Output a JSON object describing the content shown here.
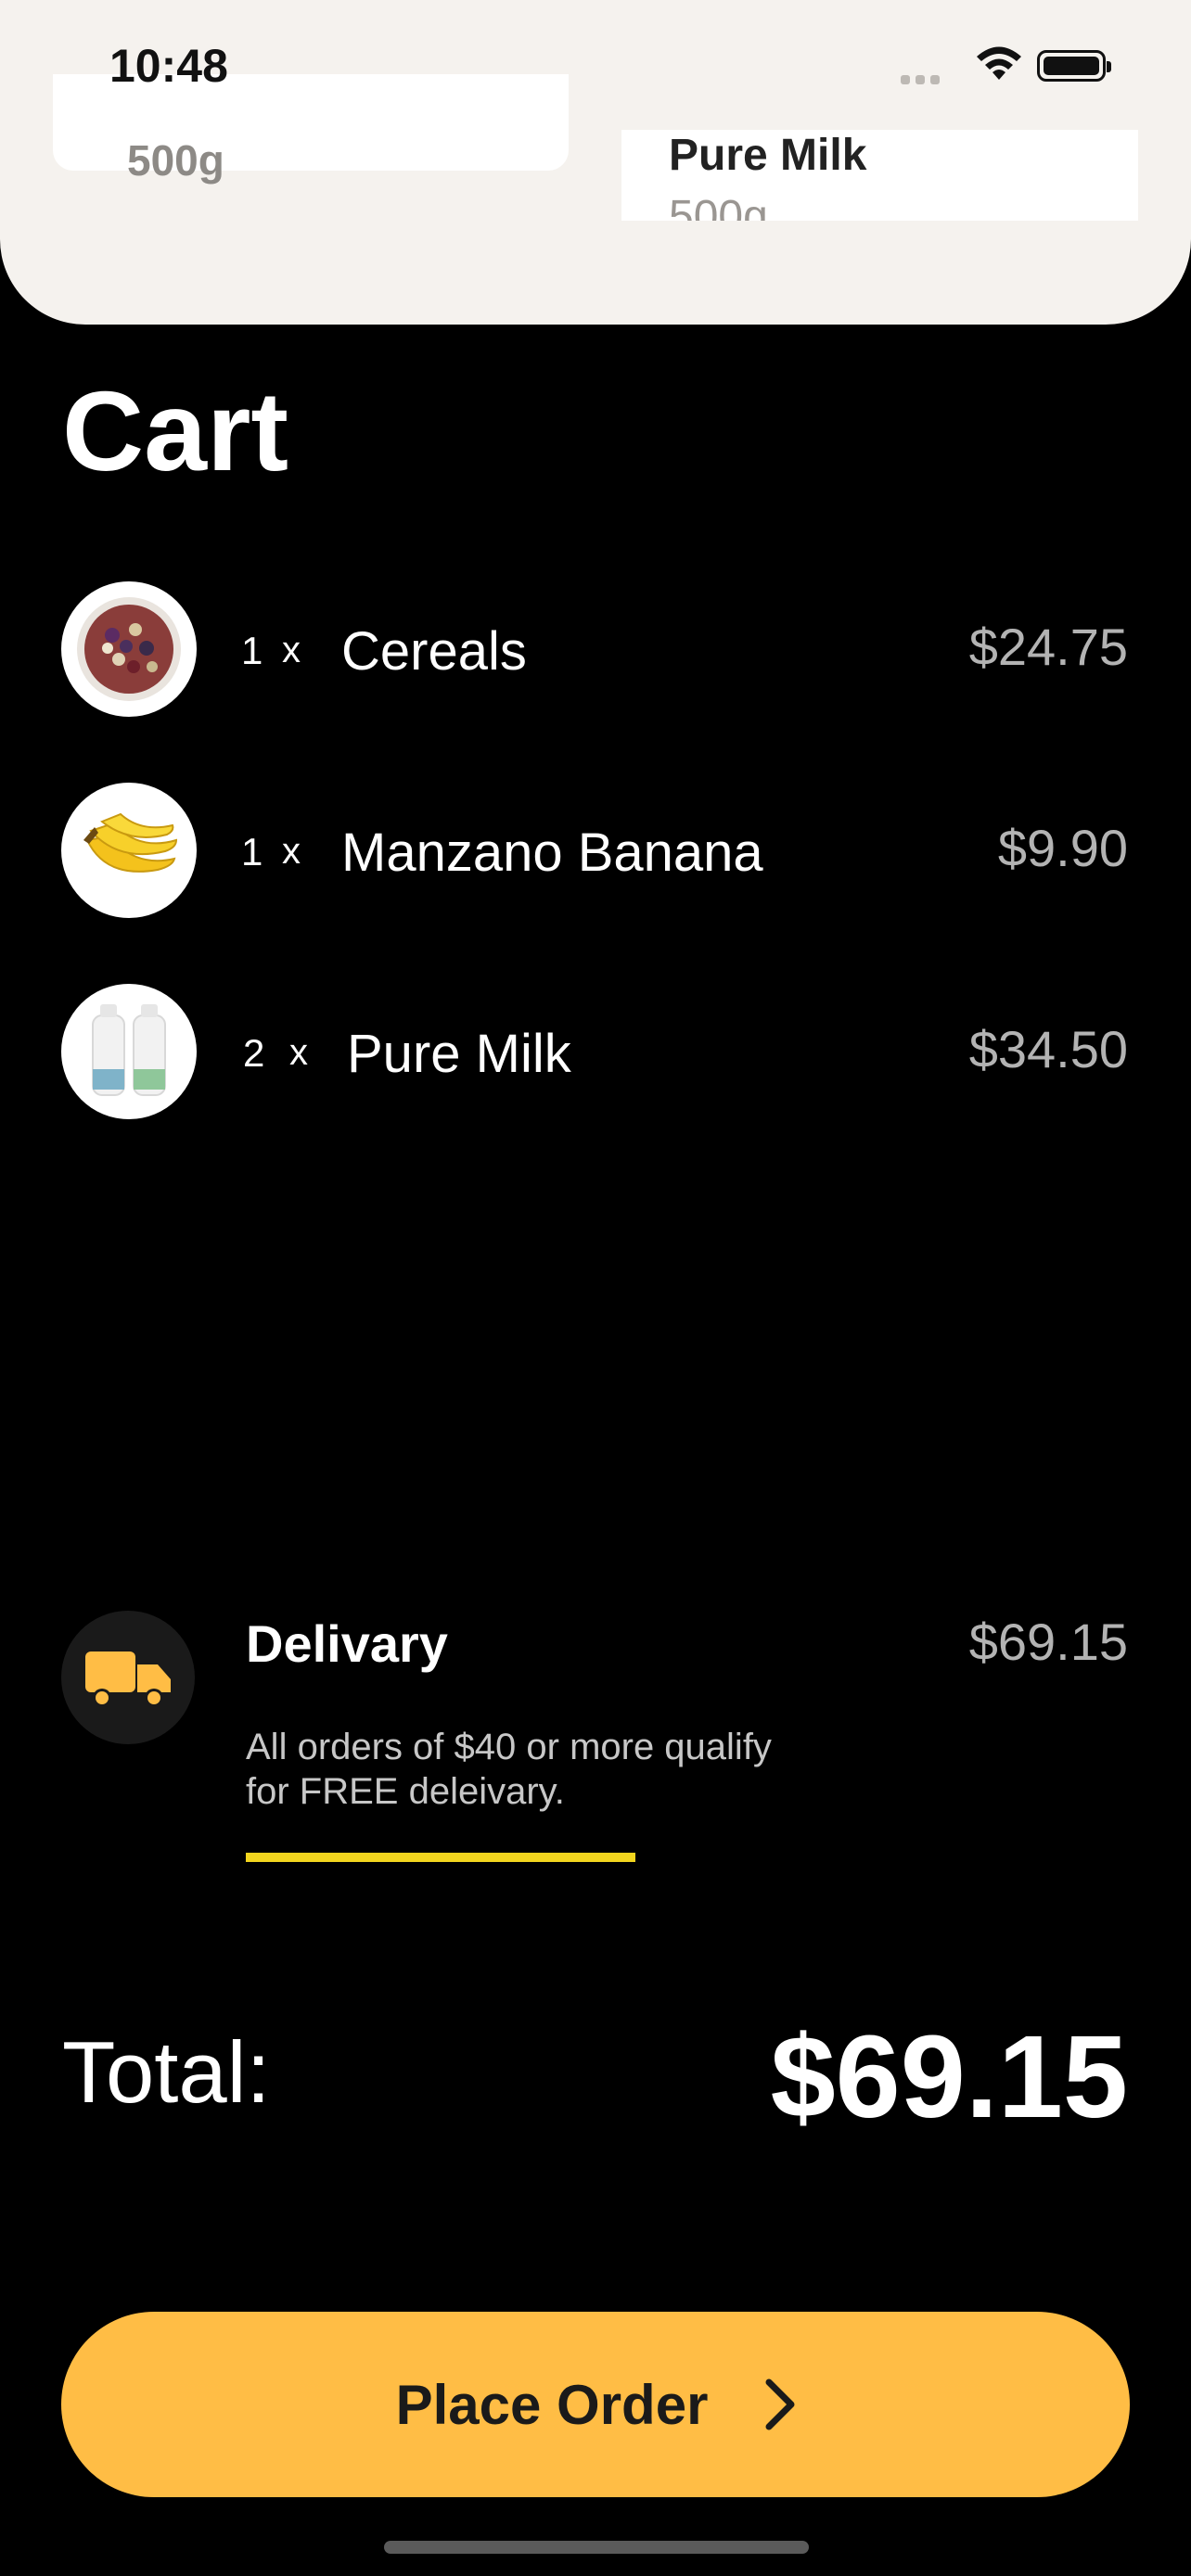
{
  "status_bar": {
    "time": "10:48"
  },
  "top_products": {
    "left_card_text": "500g",
    "right_card": {
      "title": "Pure Milk",
      "weight": "500g"
    }
  },
  "heading": "Cart",
  "cart_items": [
    {
      "qty": "1",
      "times": "x",
      "name": "Cereals",
      "price": "$24.75",
      "icon": "cereal-bowl-icon"
    },
    {
      "qty": "1",
      "times": "x",
      "name": "Manzano Banana",
      "price": "$9.90",
      "icon": "banana-icon"
    },
    {
      "qty": "2",
      "times": "x",
      "name": "Pure Milk",
      "price": "$34.50",
      "icon": "milk-bottle-icon"
    }
  ],
  "delivery": {
    "title": "Delivary",
    "price": "$69.15",
    "note": "All orders of $40 or more qualify for FREE deleivary.",
    "icon": "delivery-truck-icon",
    "progress_color": "#f2d51e"
  },
  "total": {
    "label": "Total:",
    "value": "$69.15"
  },
  "place_order": {
    "label": "Place Order",
    "icon": "chevron-right-icon",
    "color": "#ffbd45"
  },
  "colors": {
    "background": "#000000",
    "panel": "#f5f2ee",
    "accent": "#ffbd45"
  }
}
